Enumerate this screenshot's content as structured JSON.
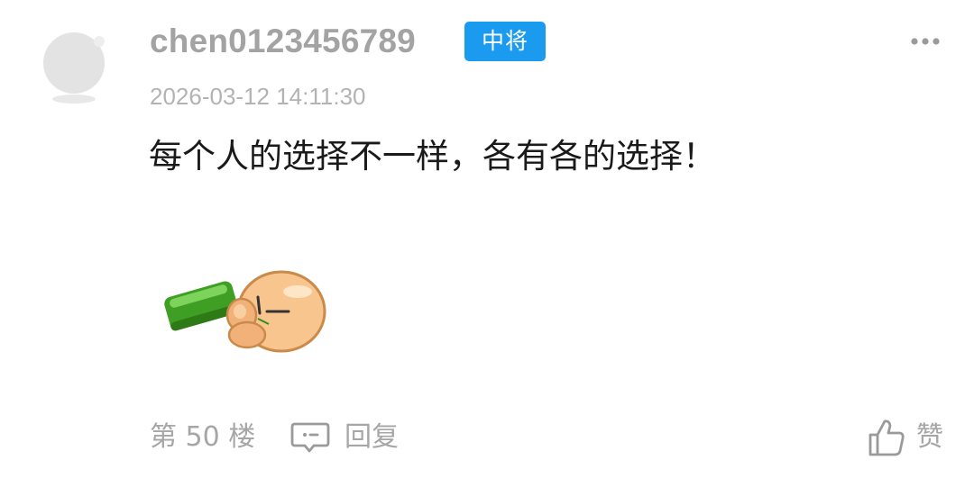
{
  "comment": {
    "username": "chen0123456789",
    "badge": "中将",
    "timestamp": "2026-03-12 14:11:30",
    "text": "每个人的选择不一样，各有各的选择！",
    "sticker": "thumbs-up-sticker"
  },
  "footer": {
    "floor": "第 50 楼",
    "reply_label": "回复",
    "like_label": "赞"
  },
  "colors": {
    "badge": "#1b9bf0",
    "muted_text": "#a6a6a6",
    "body_text": "#1a1a1a"
  },
  "icons": {
    "avatar": "default-avatar-icon",
    "more": "more-dots-icon",
    "reply": "comment-bubble-icon",
    "like": "thumbs-up-icon"
  }
}
